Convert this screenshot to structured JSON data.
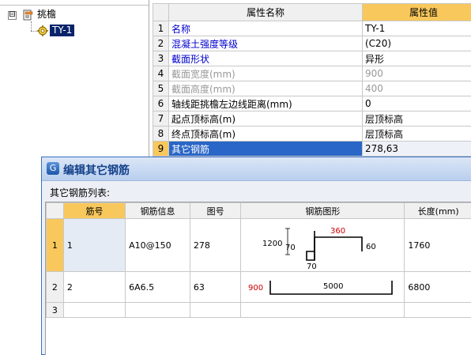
{
  "tree": {
    "root_label": "挑檐",
    "expander_symbol": "⊟",
    "child_label": "TY-1",
    "root_icon": "document-icon",
    "child_icon": "gear-icon"
  },
  "property_grid": {
    "headers": [
      "属性名称",
      "属性值"
    ],
    "rows": [
      {
        "num": "1",
        "name": "名称",
        "value": "TY-1",
        "style": "blue"
      },
      {
        "num": "2",
        "name": "混凝土强度等级",
        "value": "(C20)",
        "style": "blue"
      },
      {
        "num": "3",
        "name": "截面形状",
        "value": "异形",
        "style": "blue"
      },
      {
        "num": "4",
        "name": "截面宽度(mm)",
        "value": "900",
        "style": "gray"
      },
      {
        "num": "5",
        "name": "截面高度(mm)",
        "value": "400",
        "style": "gray"
      },
      {
        "num": "6",
        "name": "轴线距挑檐左边线距离(mm)",
        "value": "0",
        "style": "black"
      },
      {
        "num": "7",
        "name": "起点顶标高(m)",
        "value": "层顶标高",
        "style": "black"
      },
      {
        "num": "8",
        "name": "终点顶标高(m)",
        "value": "层顶标高",
        "style": "black"
      },
      {
        "num": "9",
        "name": "其它钢筋",
        "value": "278,63",
        "style": "selected"
      }
    ]
  },
  "dialog": {
    "title": "编辑其它钢筋",
    "list_label": "其它钢筋列表:",
    "columns": [
      "筋号",
      "钢筋信息",
      "图号",
      "钢筋图形",
      "长度(mm)"
    ],
    "rows": [
      {
        "num": "1",
        "bar_no": "1",
        "info": "A10@150",
        "fig": "278",
        "length": "1760",
        "shape": {
          "left_dim": "1200",
          "hook_dim": "70",
          "top_dim": "360",
          "end_dim": "60",
          "bottom_dim": "70"
        }
      },
      {
        "num": "2",
        "bar_no": "2",
        "info": "6A6.5",
        "fig": "63",
        "length": "6800",
        "shape": {
          "left_dim": "900",
          "span_dim": "5000"
        }
      },
      {
        "num": "3",
        "bar_no": "",
        "info": "",
        "fig": "",
        "length": ""
      }
    ]
  },
  "colors": {
    "header_highlight": "#f8c85c",
    "selection_blue": "#2a66c7",
    "dimension_red": "#cc0000",
    "link_blue": "#0000cc"
  }
}
